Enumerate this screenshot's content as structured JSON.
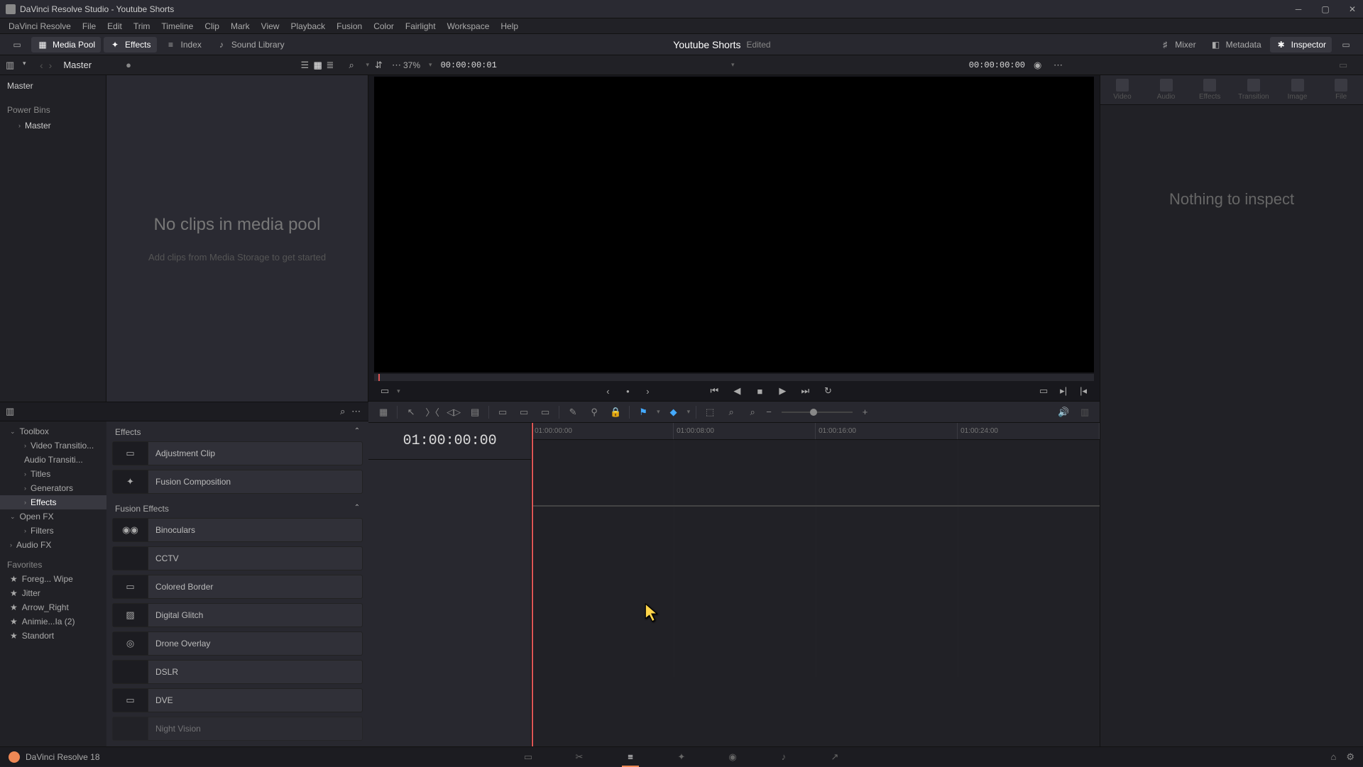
{
  "window": {
    "title": "DaVinci Resolve Studio - Youtube Shorts"
  },
  "menu": [
    "DaVinci Resolve",
    "File",
    "Edit",
    "Trim",
    "Timeline",
    "Clip",
    "Mark",
    "View",
    "Playback",
    "Fusion",
    "Color",
    "Fairlight",
    "Workspace",
    "Help"
  ],
  "topToolbar": {
    "mediaPool": "Media Pool",
    "effects": "Effects",
    "index": "Index",
    "soundLibrary": "Sound Library",
    "mixer": "Mixer",
    "metadata": "Metadata",
    "inspector": "Inspector"
  },
  "project": {
    "title": "Youtube Shorts",
    "status": "Edited"
  },
  "secondary": {
    "binName": "Master",
    "zoom": "37%",
    "sourceTC": "00:00:00:01",
    "recordTC": "00:00:00:00"
  },
  "binList": {
    "master": "Master",
    "powerBins": "Power Bins",
    "powerMaster": "Master"
  },
  "mediaPoolEmpty": {
    "title": "No clips in media pool",
    "sub": "Add clips from Media Storage to get started"
  },
  "effectsTree": {
    "toolbox": "Toolbox",
    "videoTransitions": "Video Transitio...",
    "audioTransitions": "Audio Transiti...",
    "titles": "Titles",
    "generators": "Generators",
    "effects": "Effects",
    "openfx": "Open FX",
    "filters": "Filters",
    "audiofx": "Audio FX",
    "favoritesHeading": "Favorites",
    "favorites": [
      "Foreg... Wipe",
      "Jitter",
      "Arrow_Right",
      "Animie...Ia (2)",
      "Standort"
    ]
  },
  "effectsList": {
    "cat1": "Effects",
    "cat1Items": [
      "Adjustment Clip",
      "Fusion Composition"
    ],
    "cat2": "Fusion Effects",
    "cat2Items": [
      "Binoculars",
      "CCTV",
      "Colored Border",
      "Digital Glitch",
      "Drone Overlay",
      "DSLR",
      "DVE",
      "Night Vision"
    ]
  },
  "inspectorTabs": [
    "Video",
    "Audio",
    "Effects",
    "Transition",
    "Image",
    "File"
  ],
  "inspector": {
    "empty": "Nothing to inspect"
  },
  "timeline": {
    "current": "01:00:00:00",
    "ticks": [
      "01:00:00:00",
      "01:00:08:00",
      "01:00:16:00",
      "01:00:24:00"
    ]
  },
  "bottom": {
    "appLabel": "DaVinci Resolve 18"
  }
}
